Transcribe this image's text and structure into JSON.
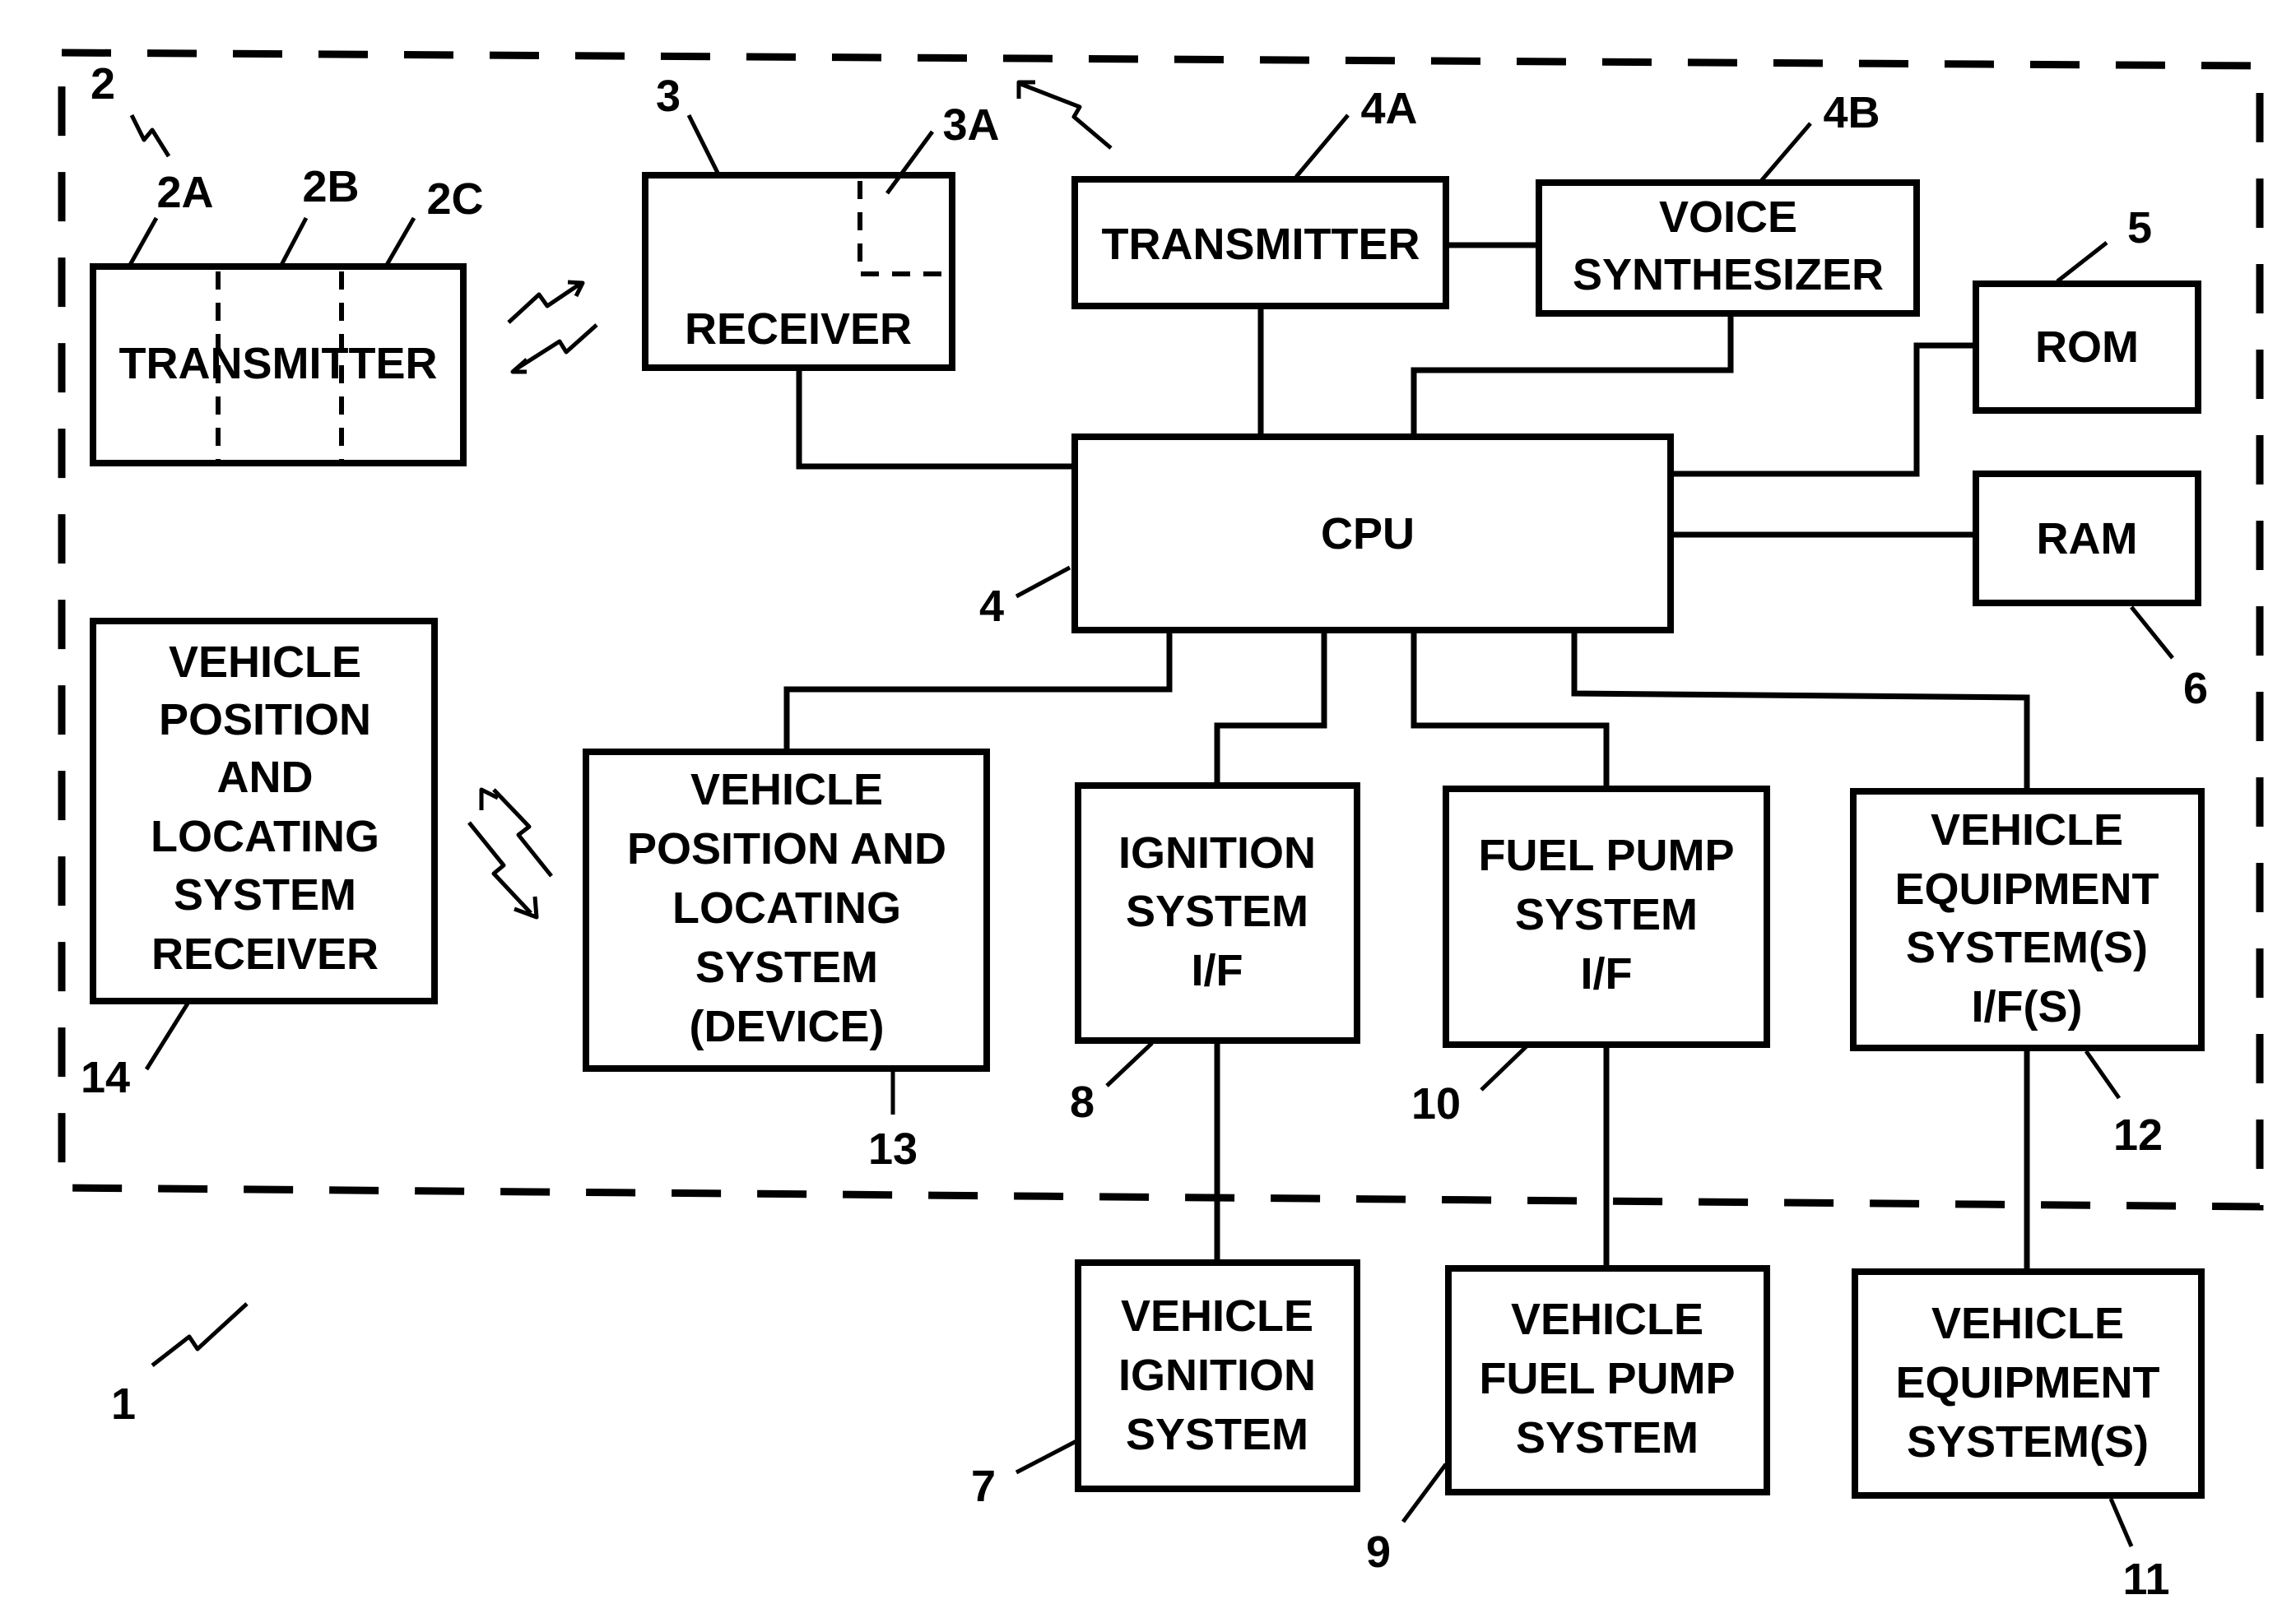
{
  "diagram": {
    "system_ref": "1",
    "enclosure_ref": "2",
    "blocks": [
      {
        "id": "transmitter_2",
        "ref": "2",
        "lines": [
          "TRANSMITTER"
        ],
        "sub_refs": [
          "2A",
          "2B",
          "2C"
        ]
      },
      {
        "id": "receiver_3",
        "ref": "3",
        "lines": [
          "RECEIVER"
        ],
        "sub_refs": [
          "3A"
        ]
      },
      {
        "id": "transmitter_4a",
        "ref": "4A",
        "lines": [
          "TRANSMITTER"
        ]
      },
      {
        "id": "voice_synth_4b",
        "ref": "4B",
        "lines": [
          "VOICE",
          "SYNTHESIZER"
        ]
      },
      {
        "id": "rom_5",
        "ref": "5",
        "lines": [
          "ROM"
        ]
      },
      {
        "id": "ram_6",
        "ref": "6",
        "lines": [
          "RAM"
        ]
      },
      {
        "id": "cpu_4",
        "ref": "4",
        "lines": [
          "CPU"
        ]
      },
      {
        "id": "vpls_receiver_14",
        "ref": "14",
        "lines": [
          "VEHICLE",
          "POSITION",
          "AND",
          "LOCATING",
          "SYSTEM",
          "RECEIVER"
        ]
      },
      {
        "id": "vpls_device_13",
        "ref": "13",
        "lines": [
          "VEHICLE",
          "POSITION AND",
          "LOCATING",
          "SYSTEM",
          "(DEVICE)"
        ]
      },
      {
        "id": "ignition_if_8",
        "ref": "8",
        "lines": [
          "IGNITION",
          "SYSTEM",
          "I/F"
        ]
      },
      {
        "id": "fuel_pump_if_10",
        "ref": "10",
        "lines": [
          "FUEL PUMP",
          "SYSTEM",
          "I/F"
        ]
      },
      {
        "id": "equipment_if_12",
        "ref": "12",
        "lines": [
          "VEHICLE",
          "EQUIPMENT",
          "SYSTEM(S)",
          "I/F(S)"
        ]
      },
      {
        "id": "vehicle_ignition_7",
        "ref": "7",
        "lines": [
          "VEHICLE",
          "IGNITION",
          "SYSTEM"
        ]
      },
      {
        "id": "vehicle_fuel_pump_9",
        "ref": "9",
        "lines": [
          "VEHICLE",
          "FUEL PUMP",
          "SYSTEM"
        ]
      },
      {
        "id": "vehicle_equipment_11",
        "ref": "11",
        "lines": [
          "VEHICLE",
          "EQUIPMENT",
          "SYSTEM(S)"
        ]
      }
    ],
    "connections": [
      [
        "receiver_3",
        "cpu_4"
      ],
      [
        "transmitter_4a",
        "cpu_4"
      ],
      [
        "transmitter_4a",
        "voice_synth_4b"
      ],
      [
        "voice_synth_4b",
        "cpu_4"
      ],
      [
        "rom_5",
        "cpu_4"
      ],
      [
        "ram_6",
        "cpu_4"
      ],
      [
        "cpu_4",
        "vpls_device_13"
      ],
      [
        "cpu_4",
        "ignition_if_8"
      ],
      [
        "cpu_4",
        "fuel_pump_if_10"
      ],
      [
        "cpu_4",
        "equipment_if_12"
      ],
      [
        "ignition_if_8",
        "vehicle_ignition_7"
      ],
      [
        "fuel_pump_if_10",
        "vehicle_fuel_pump_9"
      ],
      [
        "equipment_if_12",
        "vehicle_equipment_11"
      ]
    ],
    "wireless_links": [
      [
        "transmitter_2",
        "receiver_3"
      ],
      [
        "transmitter_4a",
        "outside"
      ],
      [
        "vpls_receiver_14",
        "vpls_device_13"
      ]
    ]
  }
}
